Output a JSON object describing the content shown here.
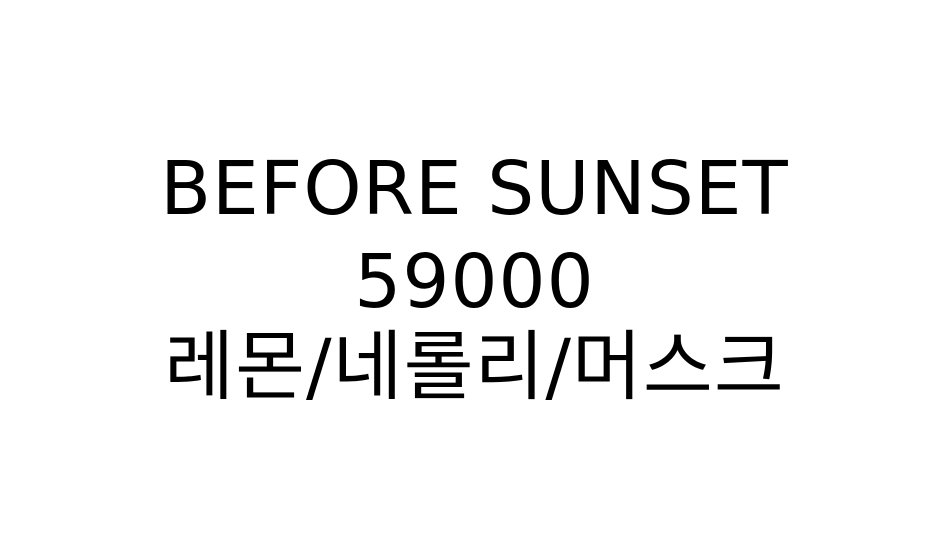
{
  "product": {
    "name": "BEFORE SUNSET",
    "price": "59000",
    "notes": "레몬/네롤리/머스크"
  },
  "colors": {
    "background": "#ffffff",
    "text": "#000000"
  }
}
